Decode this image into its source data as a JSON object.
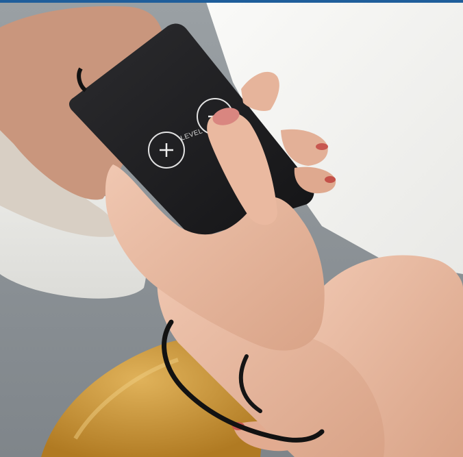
{
  "photo": {
    "remote_label": "LEVEL",
    "icons": [
      "plus-icon",
      "minus-icon"
    ],
    "colors": {
      "top_stripe": "#1f5e9b",
      "remote_body": "#1c1c1e",
      "skin": "#e7b79f",
      "shirt": "#f4f4f2",
      "cushion": "#c8922f",
      "floor": "#8e9397",
      "basin": "#eeeeea",
      "cable": "#121212"
    }
  }
}
